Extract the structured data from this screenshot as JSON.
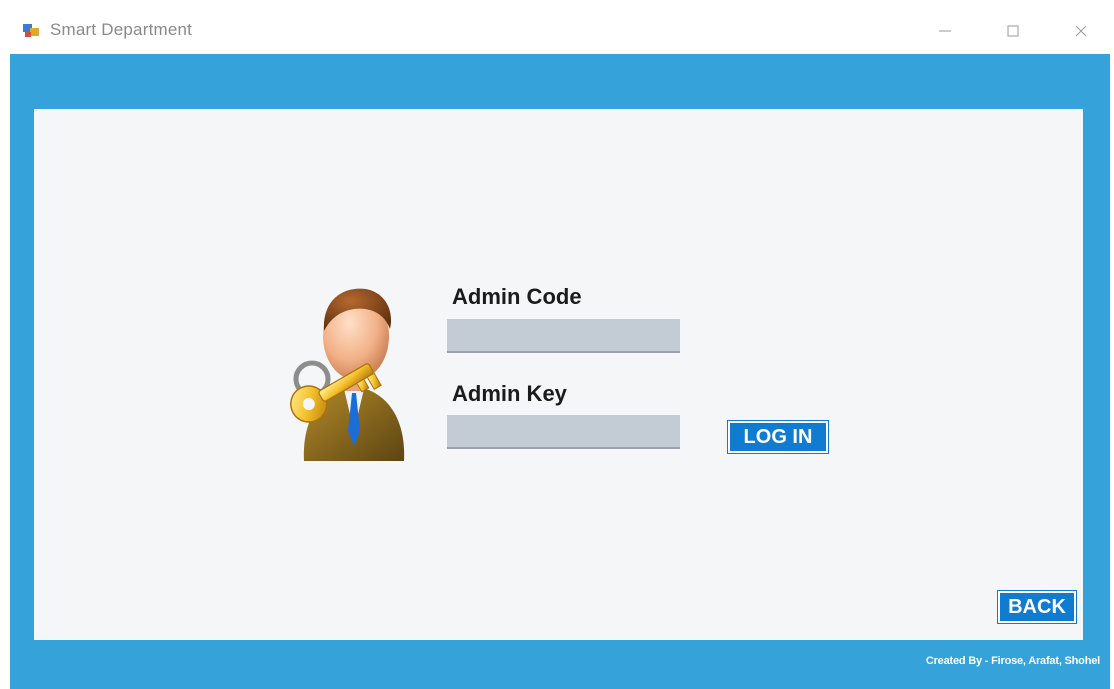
{
  "window": {
    "title": "Smart Department",
    "icon": "app-icon",
    "controls": [
      "minimize-icon",
      "maximize-icon",
      "close-icon"
    ]
  },
  "colors": {
    "frame": "#35a2d9",
    "panel": "#f4f6f8",
    "field": "#c3cbd5",
    "button": "#0f7bd1"
  },
  "login": {
    "admin_code_label": "Admin Code",
    "admin_code_value": "",
    "admin_key_label": "Admin Key",
    "admin_key_value": "",
    "login_button": "LOG IN",
    "illustration": "admin-key-avatar-icon"
  },
  "footer": {
    "back_button": "BACK",
    "credit": "Created By - Firose, Arafat, Shohel"
  }
}
